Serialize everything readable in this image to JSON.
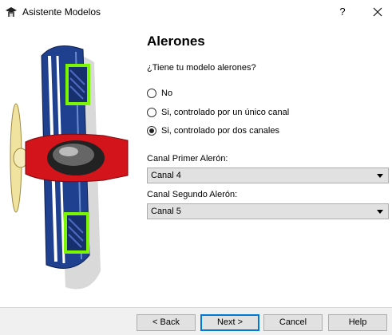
{
  "window": {
    "title": "Asistente Modelos",
    "help_label": "?"
  },
  "page": {
    "heading": "Alerones",
    "question": "¿Tiene tu modelo alerones?"
  },
  "options": [
    {
      "label": "No",
      "checked": false
    },
    {
      "label": "Si, controlado por un único canal",
      "checked": false
    },
    {
      "label": "Si, controlado por dos canales",
      "checked": true
    }
  ],
  "fields": {
    "first_label": "Canal Primer Alerón:",
    "first_value": "Canal 4",
    "second_label": "Canal Segundo Alerón:",
    "second_value": "Canal 5"
  },
  "buttons": {
    "back": "< Back",
    "next": "Next >",
    "cancel": "Cancel",
    "help": "Help"
  },
  "colors": {
    "wing_blue": "#1f3f8f",
    "fuselage_red": "#d3141b",
    "aileron_highlight": "#7cf500",
    "propeller": "#f0e3a0"
  }
}
